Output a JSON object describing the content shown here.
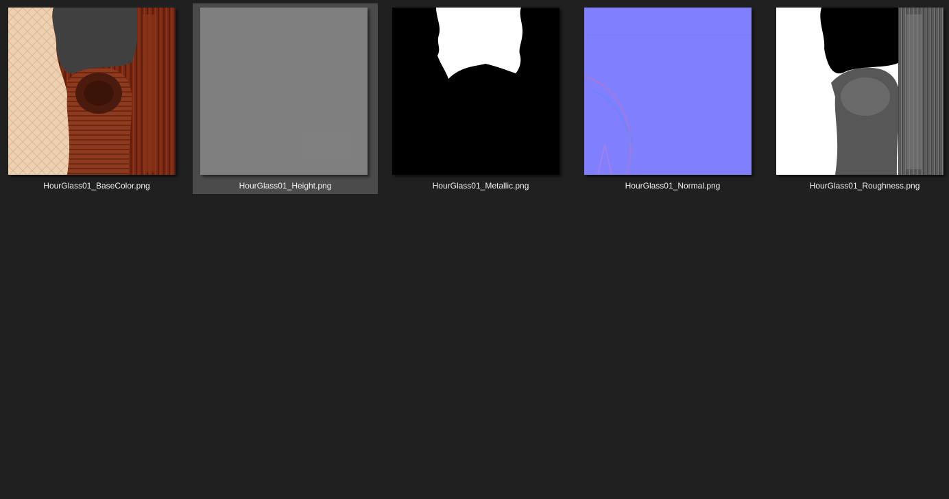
{
  "files": [
    {
      "name": "HourGlass01_BaseColor.png",
      "preview_icon": "basecolor-texture-thumbnail",
      "selected": false
    },
    {
      "name": "HourGlass01_Height.png",
      "preview_icon": "height-texture-thumbnail",
      "selected": true
    },
    {
      "name": "HourGlass01_Metallic.png",
      "preview_icon": "metallic-texture-thumbnail",
      "selected": false
    },
    {
      "name": "HourGlass01_Normal.png",
      "preview_icon": "normal-texture-thumbnail",
      "selected": false
    },
    {
      "name": "HourGlass01_Roughness.png",
      "preview_icon": "roughness-texture-thumbnail",
      "selected": false
    }
  ],
  "colors": {
    "background": "#202020",
    "selection": "#4b4b4b",
    "label_text": "#f0f0f0"
  }
}
